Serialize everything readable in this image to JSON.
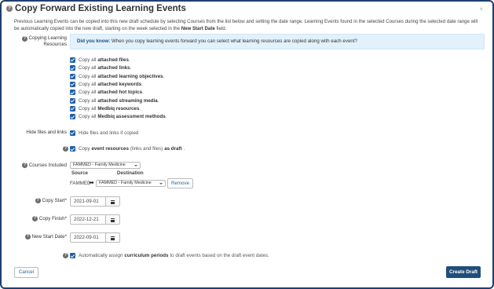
{
  "dialog": {
    "title": "Copy Forward Existing Learning Events",
    "close_symbol": "×",
    "intro_part1": "Previous Learning Events can be copied into this new draft schedule by selecting Courses from the list below and setting the date range. Learning Events found in the selected Courses during the selected date range will be automatically copied into the new draft, starting on the week selected in the ",
    "intro_bold": "New Start Date",
    "intro_part2": " field."
  },
  "resources": {
    "label_line1": "Copying Learning",
    "label_line2": "Resources",
    "tip_bold": "Did you know:",
    "tip_text": " When you copy learning events forward you can select what learning resources are copied along with each event?",
    "options": [
      {
        "pre": "Copy all",
        "bold": "attached files",
        "post": "."
      },
      {
        "pre": "Copy all",
        "bold": "attached links",
        "post": "."
      },
      {
        "pre": "Copy all",
        "bold": "attached learning objectives",
        "post": "."
      },
      {
        "pre": "Copy all",
        "bold": "attached keywords",
        "post": "."
      },
      {
        "pre": "Copy all",
        "bold": "attached hot topics",
        "post": "."
      },
      {
        "pre": "Copy all",
        "bold": "attached streaming media",
        "post": "."
      },
      {
        "pre": "Copy all",
        "bold": "Medbiq resources",
        "post": "."
      },
      {
        "pre": "Copy all",
        "bold": "Medbiq assessment methods",
        "post": "."
      }
    ]
  },
  "hide_files": {
    "label": "Hide files and links",
    "option": "Hide files and links if copied"
  },
  "event_resources": {
    "pre": "Copy",
    "bold": "event resources",
    "mid": "(links and files)",
    "bold2": "as draft",
    "post": "."
  },
  "courses": {
    "label": "Courses Included",
    "selected": "FAMMED - Family Medicine",
    "source_header": "Source",
    "destination_header": "Destination",
    "source_value": "FAMMED",
    "arrow": "➡",
    "destination_selected": "FAMMED - Family Medicine",
    "remove_label": "Remove"
  },
  "dates": {
    "copy_start_label": "Copy Start*",
    "copy_start_value": "2021-09-01",
    "copy_finish_label": "Copy Finish*",
    "copy_finish_value": "2022-12-21",
    "new_start_label": "New Start Date*",
    "new_start_value": "2022-09-01"
  },
  "curriculum": {
    "pre": "Automatically assign",
    "bold": "curriculum periods",
    "post": "to draft events based on the draft event dates."
  },
  "footer": {
    "cancel_label": "Cancel",
    "create_label": "Create Draft"
  }
}
